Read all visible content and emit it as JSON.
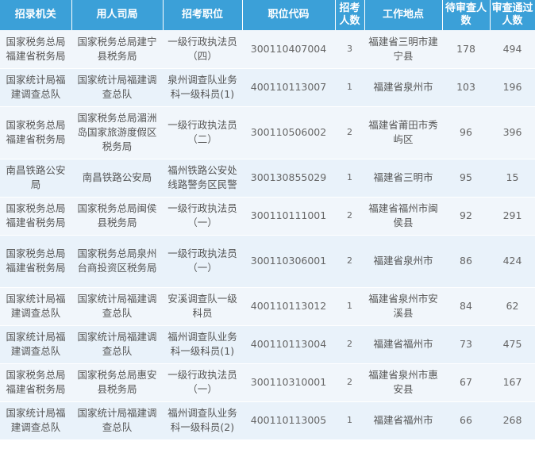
{
  "headers": [
    "招录机关",
    "用人司局",
    "招考职位",
    "职位代码",
    "招考人数",
    "工作地点",
    "待审查人数",
    "审查通过人数"
  ],
  "rows": [
    {
      "org": "国家税务总局福建省税务局",
      "dept": "国家税务总局建宁县税务局",
      "post": "一级行政执法员（四）",
      "code": "300110407004",
      "count": "3",
      "loc": "福建省三明市建宁县",
      "pending": "178",
      "passed": "494"
    },
    {
      "org": "国家统计局福建调查总队",
      "dept": "国家统计局福建调查总队",
      "post": "泉州调查队业务科一级科员(1)",
      "code": "400110113007",
      "count": "1",
      "loc": "福建省泉州市",
      "pending": "103",
      "passed": "196"
    },
    {
      "org": "国家税务总局福建省税务局",
      "dept": "国家税务总局湄洲岛国家旅游度假区税务局",
      "post": "一级行政执法员（二）",
      "code": "300110506002",
      "count": "2",
      "loc": "福建省莆田市秀屿区",
      "pending": "96",
      "passed": "396"
    },
    {
      "org": "南昌铁路公安局",
      "dept": "南昌铁路公安局",
      "post": "福州铁路公安处线路警务区民警",
      "code": "300130855029",
      "count": "1",
      "loc": "福建省三明市",
      "pending": "95",
      "passed": "15"
    },
    {
      "org": "国家税务总局福建省税务局",
      "dept": "国家税务总局闽侯县税务局",
      "post": "一级行政执法员（一）",
      "code": "300110111001",
      "count": "2",
      "loc": "福建省福州市闽侯县",
      "pending": "92",
      "passed": "291"
    },
    {
      "org": "国家税务总局福建省税务局",
      "dept": "国家税务总局泉州台商投资区税务局",
      "post": "一级行政执法员（一）",
      "code": "300110306001",
      "count": "2",
      "loc": "福建省泉州市",
      "pending": "86",
      "passed": "424"
    },
    {
      "org": "国家统计局福建调查总队",
      "dept": "国家统计局福建调查总队",
      "post": "安溪调查队一级科员",
      "code": "400110113012",
      "count": "1",
      "loc": "福建省泉州市安溪县",
      "pending": "84",
      "passed": "62"
    },
    {
      "org": "国家统计局福建调查总队",
      "dept": "国家统计局福建调查总队",
      "post": "福州调查队业务科一级科员(1)",
      "code": "400110113004",
      "count": "2",
      "loc": "福建省福州市",
      "pending": "73",
      "passed": "475"
    },
    {
      "org": "国家税务总局福建省税务局",
      "dept": "国家税务总局惠安县税务局",
      "post": "一级行政执法员（一）",
      "code": "300110310001",
      "count": "2",
      "loc": "福建省泉州市惠安县",
      "pending": "67",
      "passed": "167"
    },
    {
      "org": "国家统计局福建调查总队",
      "dept": "国家统计局福建调查总队",
      "post": "福州调查队业务科一级科员(2)",
      "code": "400110113005",
      "count": "1",
      "loc": "福建省福州市",
      "pending": "66",
      "passed": "268"
    }
  ]
}
